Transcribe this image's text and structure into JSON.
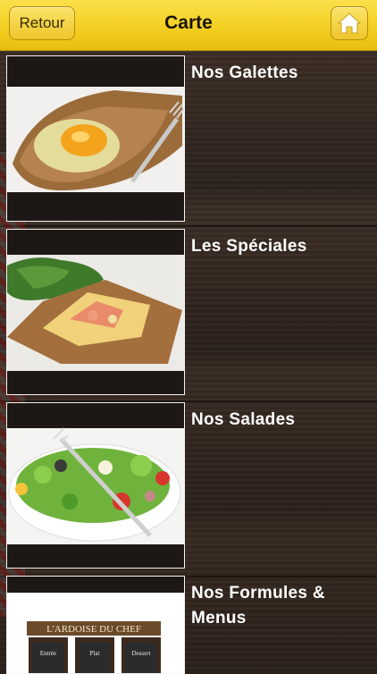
{
  "header": {
    "title": "Carte",
    "back_label": "Retour"
  },
  "menu": {
    "items": [
      {
        "label": "Nos Galettes",
        "image": "galette-photo"
      },
      {
        "label": "Les Spéciales",
        "image": "special-crepe-photo"
      },
      {
        "label": "Nos Salades",
        "image": "salad-photo"
      },
      {
        "label": "Nos Formules & Menus",
        "image": "chalkboard-photo"
      }
    ]
  },
  "chalkboard": {
    "sign": "L'ARDOISE DU CHEF",
    "boards": [
      "Entrée",
      "Plat",
      "Dessert"
    ]
  },
  "colors": {
    "header_yellow": "#f3cf22",
    "wood_dark": "#2c221c",
    "label_white": "#ffffff"
  },
  "icons": {
    "home": "home-icon"
  }
}
